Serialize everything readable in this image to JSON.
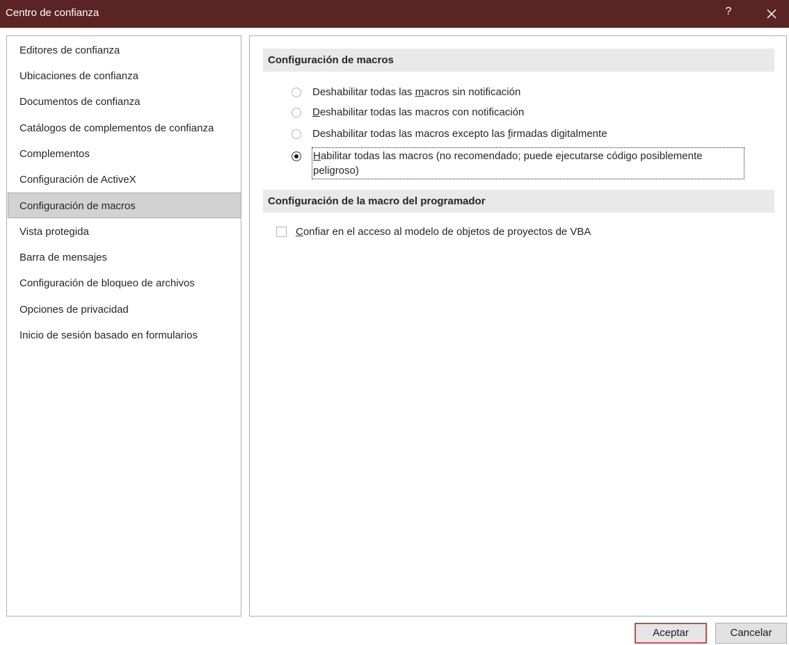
{
  "window": {
    "title": "Centro de confianza",
    "help_label": "?",
    "close_icon": "close-icon",
    "titlebar_color": "#5b2424"
  },
  "nav": {
    "items": [
      {
        "label": "Editores de confianza",
        "selected": false
      },
      {
        "label": "Ubicaciones de confianza",
        "selected": false
      },
      {
        "label": "Documentos de confianza",
        "selected": false
      },
      {
        "label": "Catálogos de complementos de confianza",
        "selected": false
      },
      {
        "label": "Complementos",
        "selected": false
      },
      {
        "label": "Configuración de ActiveX",
        "selected": false
      },
      {
        "label": "Configuración de macros",
        "selected": true
      },
      {
        "label": "Vista protegida",
        "selected": false
      },
      {
        "label": "Barra de mensajes",
        "selected": false
      },
      {
        "label": "Configuración de bloqueo de archivos",
        "selected": false
      },
      {
        "label": "Opciones de privacidad",
        "selected": false
      },
      {
        "label": "Inicio de sesión basado en formularios",
        "selected": false
      }
    ]
  },
  "macro_settings": {
    "header": "Configuración de macros",
    "options": [
      {
        "before": "Deshabilitar todas las ",
        "accel": "m",
        "after": "acros sin notificación",
        "checked": false
      },
      {
        "before": "",
        "accel": "D",
        "after": "eshabilitar todas las macros con notificación",
        "checked": false
      },
      {
        "before": "Deshabilitar todas las macros excepto las ",
        "accel": "f",
        "after": "irmadas digitalmente",
        "checked": false
      },
      {
        "before": "",
        "accel": "H",
        "after": "abilitar todas las macros (no recomendado; puede ejecutarse código posiblemente peligroso)",
        "checked": true
      }
    ]
  },
  "developer_settings": {
    "header": "Configuración de la macro del programador",
    "checkbox": {
      "before": "",
      "accel": "C",
      "after": "onfiar en el acceso al modelo de objetos de proyectos de VBA",
      "checked": false
    }
  },
  "buttons": {
    "ok_label": "Aceptar",
    "cancel_label": "Cancelar",
    "default_border_color": "#c0504d"
  }
}
